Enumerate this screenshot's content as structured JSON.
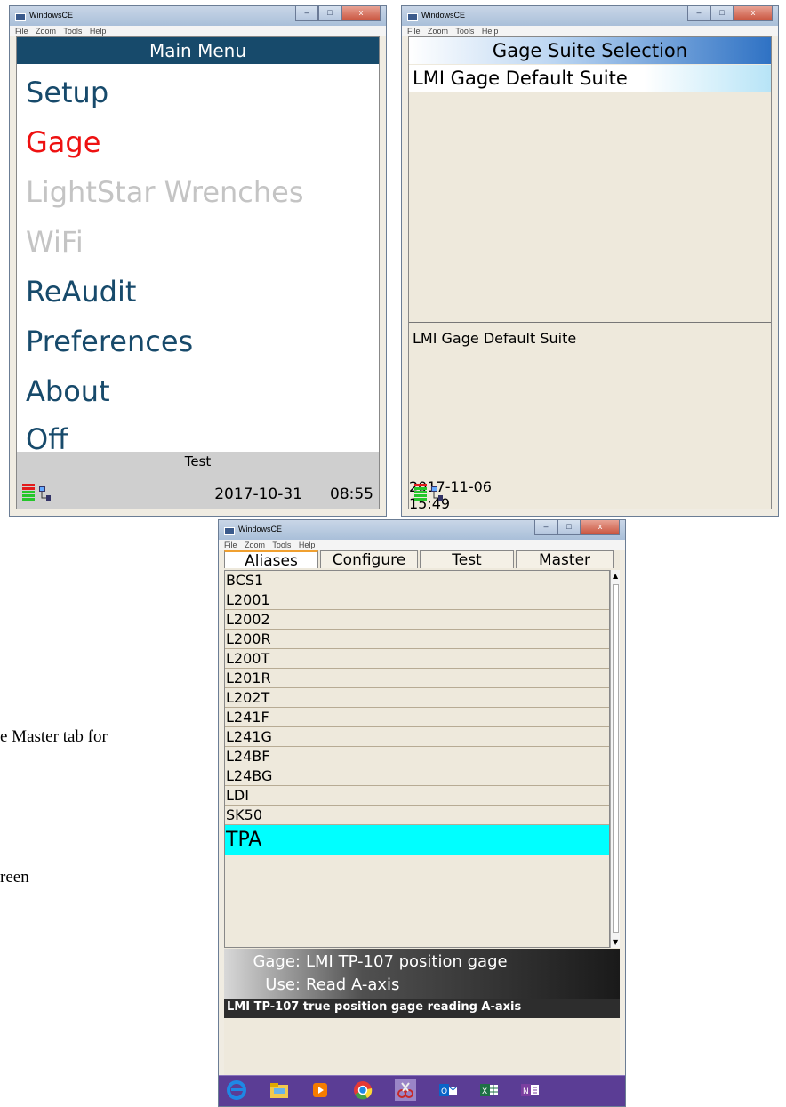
{
  "windows": [
    {
      "title": "WindowsCE",
      "menu": [
        "File",
        "Zoom",
        "Tools",
        "Help"
      ]
    },
    {
      "title": "WindowsCE",
      "menu": [
        "File",
        "Zoom",
        "Tools",
        "Help"
      ]
    },
    {
      "title": "WindowsCE",
      "menu": [
        "File",
        "Zoom",
        "Tools",
        "Help"
      ]
    }
  ],
  "main_menu": {
    "title": "Main Menu",
    "items": [
      {
        "label": "Setup",
        "state": "normal"
      },
      {
        "label": "Gage",
        "state": "active"
      },
      {
        "label": "LightStar Wrenches",
        "state": "disabled"
      },
      {
        "label": "WiFi",
        "state": "disabled"
      },
      {
        "label": "ReAudit",
        "state": "normal"
      },
      {
        "label": "Preferences",
        "state": "normal"
      },
      {
        "label": "About",
        "state": "normal"
      },
      {
        "label": "Off",
        "state": "normal"
      }
    ],
    "status_label": "Test",
    "date": "2017-10-31",
    "time": "08:55"
  },
  "gage_suite": {
    "title": "Gage Suite Selection",
    "selected": "LMI Gage Default Suite",
    "description": "LMI Gage Default Suite",
    "date": "2017-11-06",
    "time": "15:49"
  },
  "aliases_window": {
    "tabs": [
      "Aliases",
      "Configure",
      "Test",
      "Master"
    ],
    "active_tab": "Aliases",
    "rows": [
      "BCS1",
      "L2001",
      "L2002",
      "L200R",
      "L200T",
      "L201R",
      "L202T",
      "L241F",
      "L241G",
      "L24BF",
      "L24BG",
      "LDI",
      "SK50",
      "TPA"
    ],
    "selected_row": "TPA",
    "gage_label": "Gage:",
    "gage_value": "LMI TP-107 position gage",
    "use_label": "Use:",
    "use_value": "Read A-axis",
    "description": "LMI TP-107 true position gage reading A-axis"
  },
  "taskbar_icons": [
    "internet-explorer-icon",
    "file-explorer-icon",
    "media-player-icon",
    "chrome-icon",
    "snipping-tool-icon",
    "outlook-icon",
    "excel-icon",
    "onenote-icon"
  ],
  "page_fragments": {
    "line1": "e Master tab for",
    "line2": "reen"
  },
  "colors": {
    "menu_header": "#174a6b",
    "active_item": "#ee1111",
    "disabled_item": "#c4c4c4",
    "selected_row": "#00ffff",
    "taskbar": "#5b3d95"
  }
}
